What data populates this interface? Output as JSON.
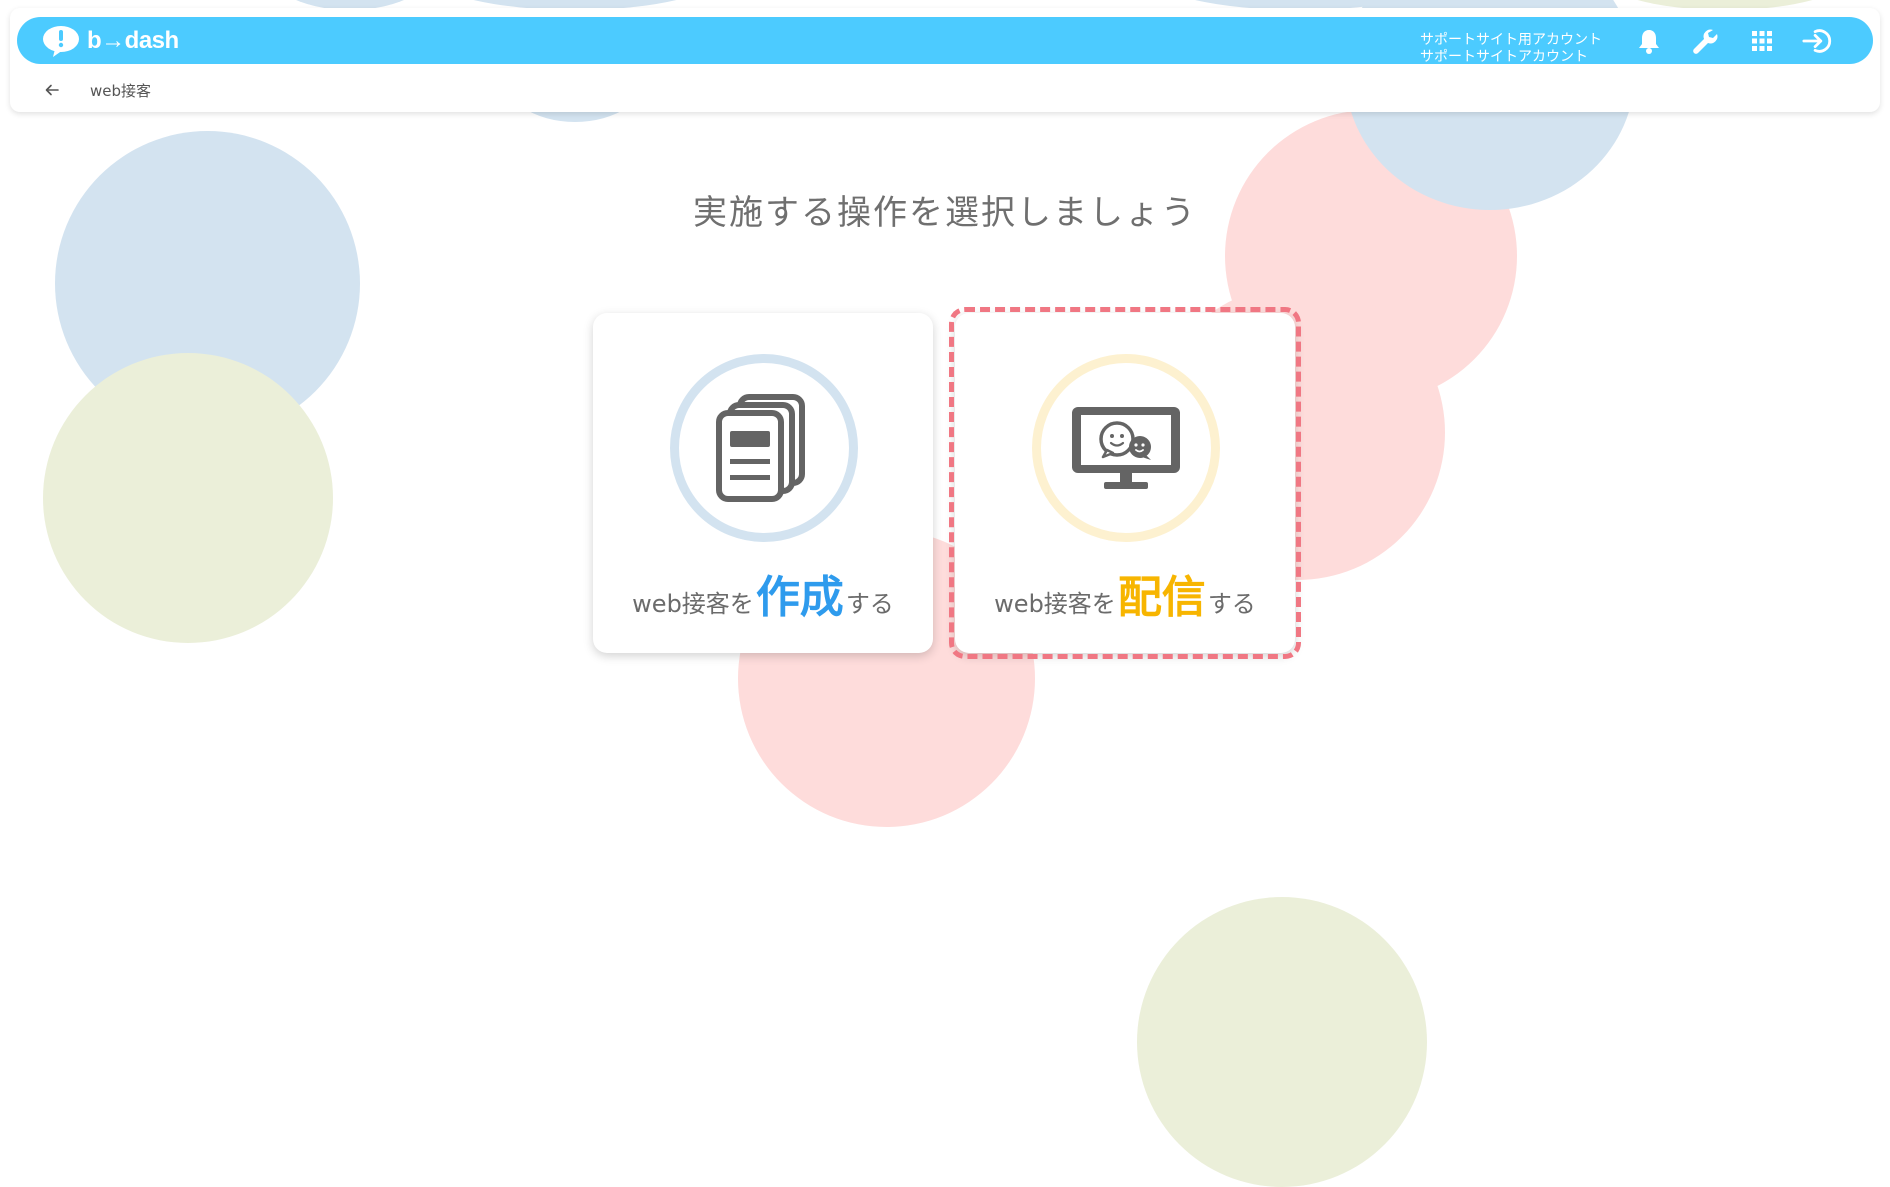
{
  "app": {
    "brand": "b→dash"
  },
  "header": {
    "account_line1": "サポートサイト用アカウント",
    "account_line2": "サポートサイトアカウント",
    "icons": [
      "bell-icon",
      "wrench-icon",
      "apps-grid-icon",
      "logout-icon"
    ]
  },
  "breadcrumb": {
    "label": "web接客"
  },
  "main": {
    "prompt": "実施する操作を選択しましょう",
    "options": [
      {
        "prefix": "web接客を",
        "verb": "作成",
        "suffix": "する",
        "icon": "document-stack-icon",
        "accent": "#2e9bed",
        "ring": "#d3e3f0"
      },
      {
        "prefix": "web接客を",
        "verb": "配信",
        "suffix": "する",
        "icon": "monitor-chat-icon",
        "accent": "#f7b500",
        "ring": "#fdf1d0",
        "highlighted": true
      }
    ]
  },
  "colors": {
    "topbar": "#4ccbff",
    "highlight_border": "#f07783",
    "bg_blue": "#d3e3f0",
    "bg_pink": "#fedcdb",
    "bg_green": "#ebefd9"
  }
}
